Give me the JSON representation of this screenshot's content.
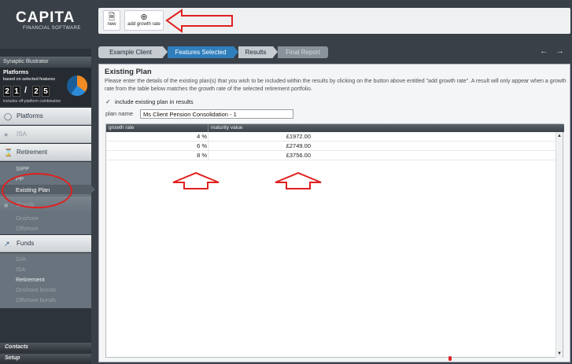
{
  "logo": {
    "brand": "CAPITA",
    "tagline": "FINANCIAL SOFTWARE"
  },
  "sidebar": {
    "tool_header": "Synaptic Illustrator",
    "counter": {
      "title": "Platforms",
      "subtitle": "based on selected features",
      "digits": [
        "2",
        "1",
        "2",
        "5"
      ],
      "separator": "/",
      "footnote": "includes off-platform combination"
    },
    "sections": {
      "platforms": {
        "label": "Platforms",
        "icon": "platforms-icon"
      },
      "isa": {
        "label": "ISA",
        "icon": "piggy-bank-icon"
      },
      "retirement": {
        "label": "Retirement",
        "icon": "hourglass-icon"
      },
      "bonds": {
        "label": "Bonds",
        "icon": "bonds-icon"
      },
      "funds": {
        "label": "Funds",
        "icon": "chart-icon"
      }
    },
    "retirement_items": [
      "SIPP",
      "PP",
      "Existing Plan"
    ],
    "bonds_items": [
      "Onshore",
      "Offshore"
    ],
    "funds_items": [
      "GIA",
      "ISA",
      "Retirement",
      "Onshore bonds",
      "Offshore bonds"
    ],
    "bottom": {
      "contacts": "Contacts",
      "setup": "Setup"
    }
  },
  "toolbar": {
    "new_label": "new",
    "add_growth_label": "add growth rate"
  },
  "breadcrumb": [
    "Example Client",
    "Features Selected",
    "Results",
    "Final Report"
  ],
  "nav_arrows": {
    "back": "←",
    "forward": "→"
  },
  "main": {
    "title": "Existing Plan",
    "instructions": "Please enter the details of the existing plan(s) that you wish to be included within the results by clicking on the button above entitled \"add growth rate\". A result will only appear when a growth rate from the table below matches the growth rate of the selected retirement portfolio.",
    "checkbox_label": "include existing plan in results",
    "plan_name_label": "plan name",
    "plan_name_value": "Ms Client Pension Consolidation - 1",
    "table": {
      "headers": [
        "growth rate",
        "maturity value"
      ],
      "rows": [
        {
          "rate": "4 %",
          "value": "£1972.00"
        },
        {
          "rate": "6 %",
          "value": "£2749.00"
        },
        {
          "rate": "8 %",
          "value": "£3756.00"
        }
      ]
    }
  },
  "colors": {
    "accent": "#2f7fbd",
    "annotation": "#e02020"
  }
}
